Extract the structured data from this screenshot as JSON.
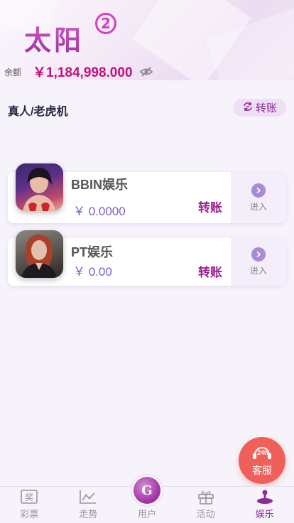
{
  "header": {
    "logo_text": "太阳",
    "logo_badge": "2",
    "balance_label": "余额",
    "balance_value": "￥1,184,998.000"
  },
  "section": {
    "title": "真人/老虎机",
    "transfer_label": "转账"
  },
  "platforms": [
    {
      "name": "BBIN娱乐",
      "amount": "￥ 0.0000",
      "transfer_label": "转账",
      "enter_label": "进入"
    },
    {
      "name": "PT娱乐",
      "amount": "￥ 0.00",
      "transfer_label": "转账",
      "enter_label": "进入"
    }
  ],
  "customer_service": {
    "badge": "24h",
    "label": "客服",
    "color": "#f0605a"
  },
  "nav": {
    "items": [
      {
        "label": "彩票",
        "icon": "lottery-ticket-icon"
      },
      {
        "label": "走势",
        "icon": "trend-chart-icon"
      },
      {
        "label": "用户",
        "icon": "user-logo-icon"
      },
      {
        "label": "活动",
        "icon": "gift-icon"
      },
      {
        "label": "娱乐",
        "icon": "joystick-icon",
        "active": true
      }
    ]
  },
  "colors": {
    "accent": "#8a2c9a",
    "balance": "#c0117d",
    "amount": "#7b5cc9"
  }
}
